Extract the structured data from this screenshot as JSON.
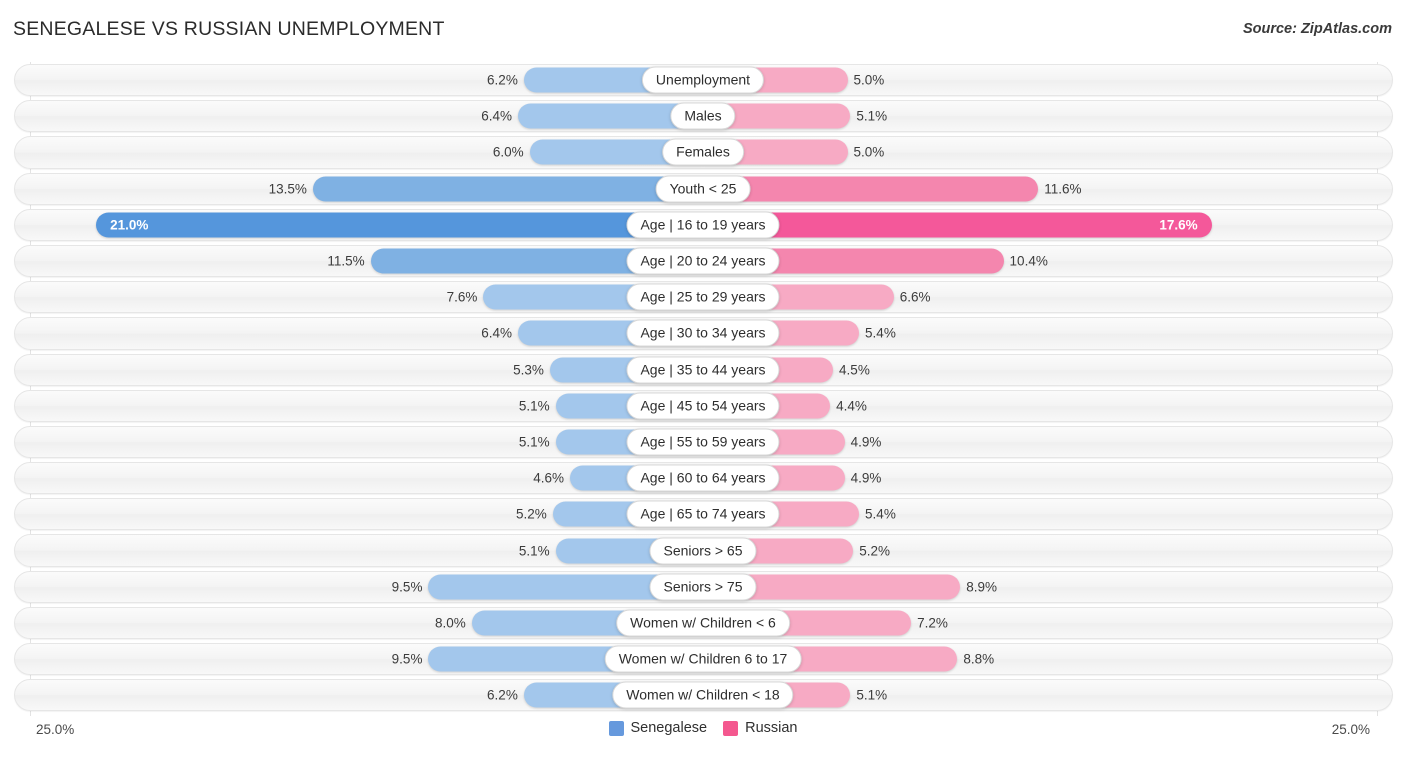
{
  "header": {
    "title": "SENEGALESE VS RUSSIAN UNEMPLOYMENT",
    "source": "Source: ZipAtlas.com"
  },
  "axis": {
    "left_end": "25.0%",
    "right_end": "25.0%",
    "max": 25.0
  },
  "legend": {
    "items": [
      {
        "label": "Senegalese",
        "color": "#6699DD"
      },
      {
        "label": "Russian",
        "color": "#F4588F"
      }
    ]
  },
  "colors": {
    "left_light": "#A3C7EC",
    "left_mid": "#7FB1E3",
    "left_strong": "#5596DC",
    "right_light": "#F7AAC4",
    "right_mid": "#F486AE",
    "right_strong": "#F4589A",
    "track": "#F5F5F5",
    "gridline": "#E3E3E3"
  },
  "chart_data": {
    "type": "bar",
    "orientation": "horizontal-diverging",
    "title": "SENEGALESE VS RUSSIAN UNEMPLOYMENT",
    "xlabel": "",
    "ylabel": "",
    "xlim": [
      25.0,
      25.0
    ],
    "grid": true,
    "legend_position": "bottom-center",
    "series": [
      {
        "name": "Senegalese",
        "side": "left",
        "values": [
          6.2,
          6.4,
          6.0,
          13.5,
          21.0,
          11.5,
          7.6,
          6.4,
          5.3,
          5.1,
          5.1,
          4.6,
          5.2,
          5.1,
          9.5,
          8.0,
          9.5,
          6.2
        ]
      },
      {
        "name": "Russian",
        "side": "right",
        "values": [
          5.0,
          5.1,
          5.0,
          11.6,
          17.6,
          10.4,
          6.6,
          5.4,
          4.5,
          4.4,
          4.9,
          4.9,
          5.4,
          5.2,
          8.9,
          7.2,
          8.8,
          5.1
        ]
      }
    ],
    "categories": [
      "Unemployment",
      "Males",
      "Females",
      "Youth < 25",
      "Age | 16 to 19 years",
      "Age | 20 to 24 years",
      "Age | 25 to 29 years",
      "Age | 30 to 34 years",
      "Age | 35 to 44 years",
      "Age | 45 to 54 years",
      "Age | 55 to 59 years",
      "Age | 60 to 64 years",
      "Age | 65 to 74 years",
      "Seniors > 65",
      "Seniors > 75",
      "Women w/ Children < 6",
      "Women w/ Children 6 to 17",
      "Women w/ Children < 18"
    ]
  },
  "rows": [
    {
      "label": "Unemployment",
      "left_value": 6.2,
      "right_value": 5.0,
      "left_text": "6.2%",
      "right_text": "5.0%",
      "highlight": false
    },
    {
      "label": "Males",
      "left_value": 6.4,
      "right_value": 5.1,
      "left_text": "6.4%",
      "right_text": "5.1%",
      "highlight": false
    },
    {
      "label": "Females",
      "left_value": 6.0,
      "right_value": 5.0,
      "left_text": "6.0%",
      "right_text": "5.0%",
      "highlight": false
    },
    {
      "label": "Youth < 25",
      "left_value": 13.5,
      "right_value": 11.6,
      "left_text": "13.5%",
      "right_text": "11.6%",
      "highlight": false
    },
    {
      "label": "Age | 16 to 19 years",
      "left_value": 21.0,
      "right_value": 17.6,
      "left_text": "21.0%",
      "right_text": "17.6%",
      "highlight": true
    },
    {
      "label": "Age | 20 to 24 years",
      "left_value": 11.5,
      "right_value": 10.4,
      "left_text": "11.5%",
      "right_text": "10.4%",
      "highlight": false
    },
    {
      "label": "Age | 25 to 29 years",
      "left_value": 7.6,
      "right_value": 6.6,
      "left_text": "7.6%",
      "right_text": "6.6%",
      "highlight": false
    },
    {
      "label": "Age | 30 to 34 years",
      "left_value": 6.4,
      "right_value": 5.4,
      "left_text": "6.4%",
      "right_text": "5.4%",
      "highlight": false
    },
    {
      "label": "Age | 35 to 44 years",
      "left_value": 5.3,
      "right_value": 4.5,
      "left_text": "5.3%",
      "right_text": "4.5%",
      "highlight": false
    },
    {
      "label": "Age | 45 to 54 years",
      "left_value": 5.1,
      "right_value": 4.4,
      "left_text": "5.1%",
      "right_text": "4.4%",
      "highlight": false
    },
    {
      "label": "Age | 55 to 59 years",
      "left_value": 5.1,
      "right_value": 4.9,
      "left_text": "5.1%",
      "right_text": "4.9%",
      "highlight": false
    },
    {
      "label": "Age | 60 to 64 years",
      "left_value": 4.6,
      "right_value": 4.9,
      "left_text": "4.6%",
      "right_text": "4.9%",
      "highlight": false
    },
    {
      "label": "Age | 65 to 74 years",
      "left_value": 5.2,
      "right_value": 5.4,
      "left_text": "5.2%",
      "right_text": "5.4%",
      "highlight": false
    },
    {
      "label": "Seniors > 65",
      "left_value": 5.1,
      "right_value": 5.2,
      "left_text": "5.1%",
      "right_text": "5.2%",
      "highlight": false
    },
    {
      "label": "Seniors > 75",
      "left_value": 9.5,
      "right_value": 8.9,
      "left_text": "9.5%",
      "right_text": "8.9%",
      "highlight": false
    },
    {
      "label": "Women w/ Children < 6",
      "left_value": 8.0,
      "right_value": 7.2,
      "left_text": "8.0%",
      "right_text": "7.2%",
      "highlight": false
    },
    {
      "label": "Women w/ Children 6 to 17",
      "left_value": 9.5,
      "right_value": 8.8,
      "left_text": "9.5%",
      "right_text": "8.8%",
      "highlight": false
    },
    {
      "label": "Women w/ Children < 18",
      "left_value": 6.2,
      "right_value": 5.1,
      "left_text": "6.2%",
      "right_text": "5.1%",
      "highlight": false
    }
  ]
}
